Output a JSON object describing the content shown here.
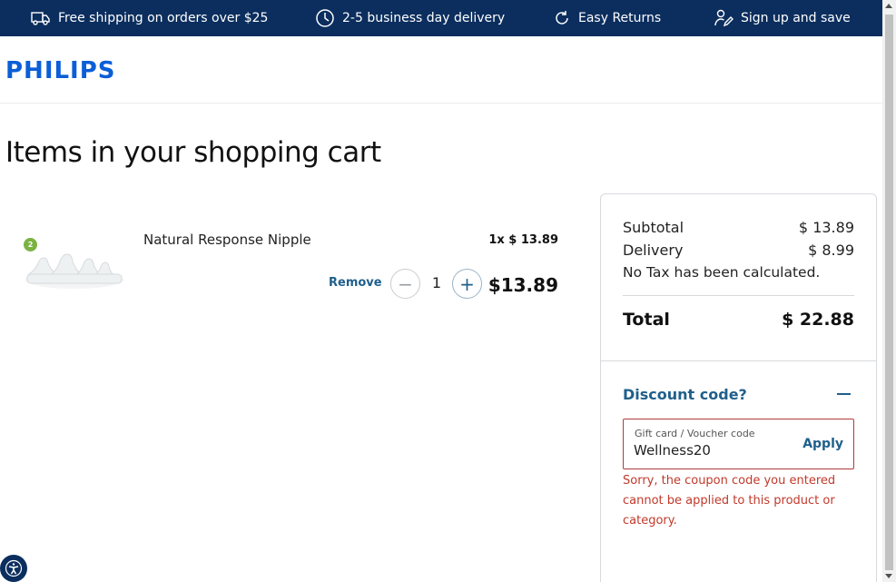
{
  "topbar": {
    "items": [
      {
        "label": "Free shipping on orders over $25",
        "icon": "truck-icon"
      },
      {
        "label": "2-5 business day delivery",
        "icon": "clock-icon"
      },
      {
        "label": "Easy Returns",
        "icon": "refresh-icon"
      },
      {
        "label": "Sign up and save",
        "icon": "signup-pen-icon"
      }
    ]
  },
  "brand": {
    "logo_text": "PHILIPS",
    "color": "#0b5ed7"
  },
  "page": {
    "title": "Items in your shopping cart"
  },
  "cart": {
    "items": [
      {
        "badge": "2",
        "name": "Natural Response Nipple",
        "unit_price": "1x $ 13.89",
        "remove_label": "Remove",
        "quantity": "1",
        "minus_symbol": "−",
        "plus_symbol": "+",
        "line_total": "$13.89"
      }
    ]
  },
  "summary": {
    "subtotal_label": "Subtotal",
    "subtotal_value": "$ 13.89",
    "delivery_label": "Delivery",
    "delivery_value": "$ 8.99",
    "tax_note": "No Tax has been calculated.",
    "total_label": "Total",
    "total_value": "$ 22.88",
    "discount": {
      "title": "Discount code?",
      "field_label": "Gift card / Voucher code",
      "field_value": "Wellness20",
      "apply_label": "Apply",
      "error": "Sorry, the coupon code you entered cannot be applied to this product or category."
    }
  },
  "colors": {
    "topbar": "#0b2e5e",
    "link": "#1f5f8b",
    "error": "#c0392b",
    "badge": "#7ab342"
  }
}
